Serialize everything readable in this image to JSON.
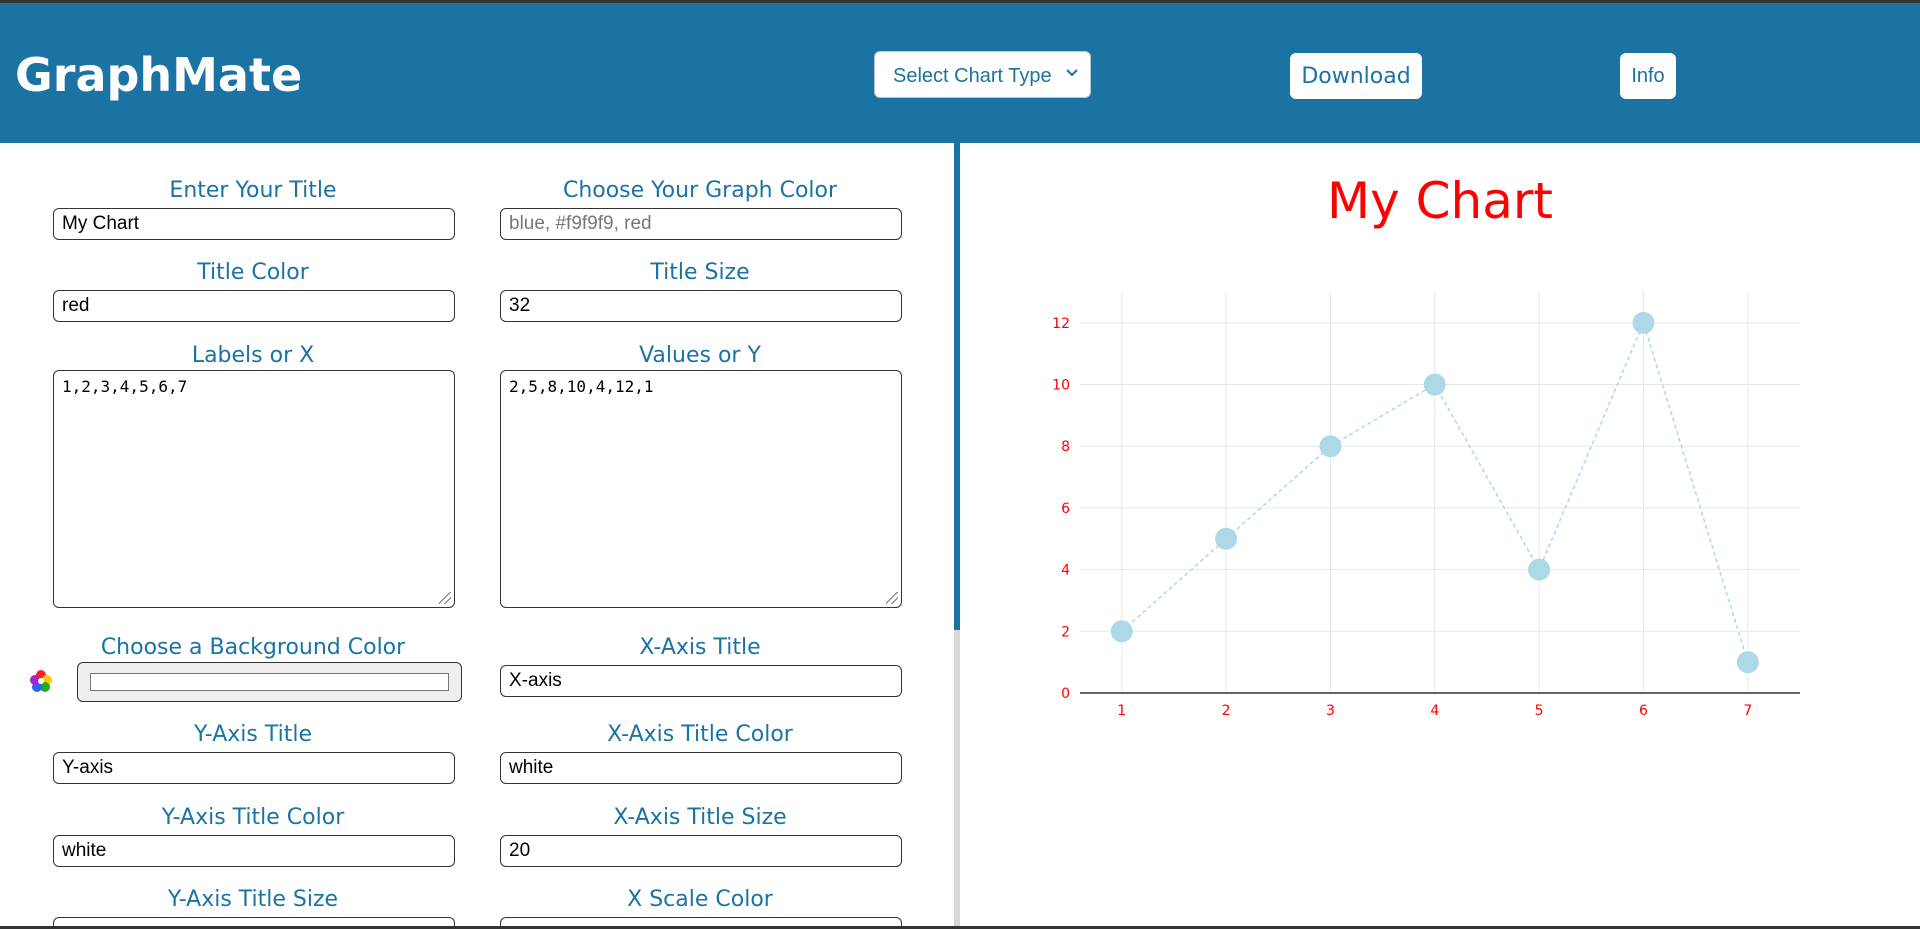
{
  "header": {
    "brand": "GraphMate",
    "chart_type_select": "Select Chart Type",
    "download_label": "Download",
    "info_label": "Info"
  },
  "form": {
    "title_label": "Enter Your Title",
    "title_value": "My Chart",
    "graph_color_label": "Choose Your Graph Color",
    "graph_color_placeholder": "blue, #f9f9f9, red",
    "title_color_label": "Title Color",
    "title_color_value": "red",
    "title_size_label": "Title Size",
    "title_size_value": "32",
    "labels_label": "Labels or X",
    "labels_value": "1,2,3,4,5,6,7",
    "values_label": "Values or Y",
    "values_value": "2,5,8,10,4,12,1",
    "bg_color_label": "Choose a Background Color",
    "x_axis_title_label": "X-Axis Title",
    "x_axis_title_value": "X-axis",
    "y_axis_title_label": "Y-Axis Title",
    "y_axis_title_value": "Y-axis",
    "x_axis_title_color_label": "X-Axis Title Color",
    "x_axis_title_color_value": "white",
    "y_axis_title_color_label": "Y-Axis Title Color",
    "y_axis_title_color_value": "white",
    "x_axis_title_size_label": "X-Axis Title Size",
    "x_axis_title_size_value": "20",
    "y_axis_title_size_label": "Y-Axis Title Size",
    "x_scale_color_label": "X Scale Color"
  },
  "colors": {
    "header_bg": "#1a73a3",
    "accent": "#1a73a3",
    "chart_title": "#ff0000",
    "tick_color": "#ff0000",
    "series_color": "#add8e6"
  },
  "chart_data": {
    "type": "scatter",
    "title": "My Chart",
    "x": [
      1,
      2,
      3,
      4,
      5,
      6,
      7
    ],
    "y": [
      2,
      5,
      8,
      10,
      4,
      12,
      1
    ],
    "xlabel": "",
    "ylabel": "",
    "ylim": [
      0,
      13
    ],
    "yticks": [
      0,
      2,
      4,
      6,
      8,
      10,
      12
    ],
    "xticks": [
      1,
      2,
      3,
      4,
      5,
      6,
      7
    ],
    "grid": true,
    "line": "dashed",
    "marker": "circle"
  }
}
